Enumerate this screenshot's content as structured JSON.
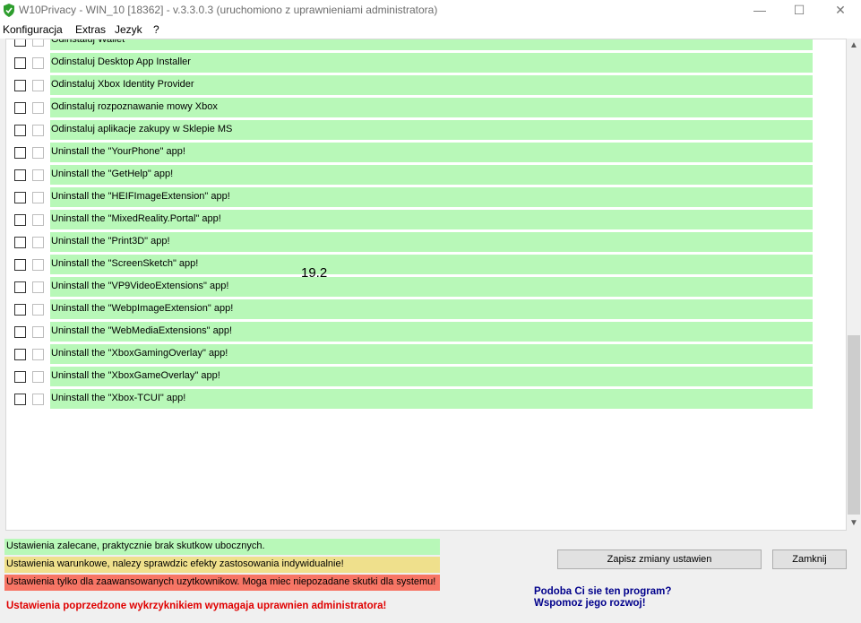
{
  "window": {
    "title": "W10Privacy - WIN_10 [18362]  - v.3.3.0.3 (uruchomiono z uprawnieniami administratora)",
    "minimize": "—",
    "maximize": "☐",
    "close": "✕"
  },
  "menu": [
    "Konfiguracja",
    "Extras",
    "Jezyk",
    "?"
  ],
  "rows": [
    "Odinstaluj Wallet",
    "Odinstaluj Desktop App Installer",
    "Odinstaluj Xbox Identity Provider",
    "Odinstaluj rozpoznawanie mowy Xbox",
    "Odinstaluj aplikacje zakupy w Sklepie MS",
    "Uninstall the \"YourPhone\" app!",
    "Uninstall the \"GetHelp\" app!",
    "Uninstall the \"HEIFImageExtension\" app!",
    "Uninstall the \"MixedReality.Portal\" app!",
    "Uninstall the \"Print3D\" app!",
    "Uninstall the \"ScreenSketch\" app!",
    "Uninstall the \"VP9VideoExtensions\" app!",
    "Uninstall the \"WebpImageExtension\" app!",
    "Uninstall the \"WebMediaExtensions\" app!",
    "Uninstall the \"XboxGamingOverlay\" app!",
    "Uninstall the \"XboxGameOverlay\" app!",
    "Uninstall the \"Xbox-TCUI\" app!"
  ],
  "center_label": "19.2",
  "scrollbar": {
    "up": "▲",
    "down": "▼"
  },
  "legend": {
    "green": "Ustawienia zalecane, praktycznie brak skutkow ubocznych.",
    "yellow": "Ustawienia warunkowe, nalezy sprawdzic efekty zastosowania indywidualnie!",
    "red": "Ustawienia tylko dla zaawansowanych uzytkownikow. Moga miec niepozadane skutki dla systemu!"
  },
  "admin_note": "Ustawienia poprzedzone wykrzyknikiem wymagaja uprawnien administratora!",
  "buttons": {
    "save": "Zapisz zmiany ustawien",
    "close": "Zamknij"
  },
  "promo": {
    "line1": "Podoba Ci sie ten program?",
    "line2": "Wspomoz jego rozwoj!"
  },
  "colors": {
    "recommended": "#b8f8b8",
    "conditional": "#efe08c",
    "advanced": "#f77565",
    "warning_text": "#e00000",
    "promo_text": "#00008b"
  }
}
